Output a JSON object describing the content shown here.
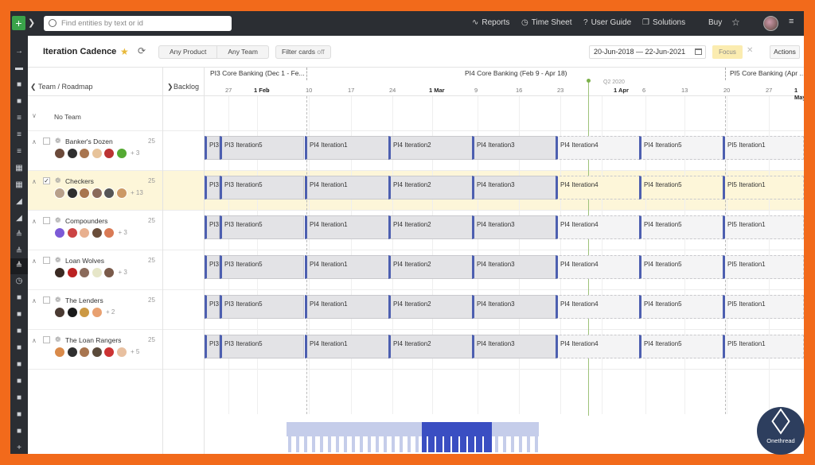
{
  "topbar": {
    "search_placeholder": "Find entities by text or id",
    "nav": [
      {
        "icon": "chart-line-icon",
        "label": "Reports"
      },
      {
        "icon": "clock-icon",
        "label": "Time Sheet"
      },
      {
        "icon": "question-icon",
        "label": "User Guide"
      },
      {
        "icon": "cube-icon",
        "label": "Solutions"
      }
    ],
    "buy_label": "Buy"
  },
  "page": {
    "title": "Iteration Cadence",
    "product_filter": "Any Product",
    "team_filter": "Any Team",
    "filter_cards_label": "Filter cards",
    "filter_cards_state": "off",
    "date_range": "20-Jun-2018 — 22-Jun-2021",
    "focus_label": "Focus",
    "actions_label": "Actions"
  },
  "grid": {
    "team_header": "Team / Roadmap",
    "backlog_header": "Backlog",
    "no_team_label": "No Team",
    "pis": [
      {
        "label": "PI3 Core Banking (Dec 1 - Fe..."
      },
      {
        "label": "PI4 Core Banking (Feb 9 - Apr 18)"
      },
      {
        "label": "PI5 Core Banking (Apr ..."
      }
    ],
    "quarter_label": "Q2 2020",
    "ticks": [
      "27",
      "1 Feb",
      "3",
      "10",
      "17",
      "24",
      "1 Mar",
      "9",
      "16",
      "23",
      "1 Apr",
      "6",
      "13",
      "20",
      "27",
      "1 May"
    ],
    "iterations": [
      "PI3",
      "PI3 Iteration5",
      "PI4 Iteration1",
      "PI4 Iteration2",
      "PI4 Iteration3",
      "PI4 Iteration4",
      "PI4 Iteration5",
      "PI5 Iteration1"
    ]
  },
  "teams": [
    {
      "name": "Banker's Dozen",
      "count": "25",
      "more": "+ 3",
      "checked": false,
      "highlight": false
    },
    {
      "name": "Checkers",
      "count": "25",
      "more": "+ 13",
      "checked": true,
      "highlight": true
    },
    {
      "name": "Compounders",
      "count": "25",
      "more": "+ 3",
      "checked": false,
      "highlight": false
    },
    {
      "name": "Loan Wolves",
      "count": "25",
      "more": "+ 3",
      "checked": false,
      "highlight": false
    },
    {
      "name": "The Lenders",
      "count": "25",
      "more": "+ 2",
      "checked": false,
      "highlight": false
    },
    {
      "name": "The Loan Rangers",
      "count": "25",
      "more": "+ 5",
      "checked": false,
      "highlight": false
    }
  ],
  "watermark": {
    "text": "Onethread"
  },
  "colors": {
    "accent": "#4d5fb0",
    "frame": "#f26a1b",
    "highlight": "#fdf6d9",
    "focus": "#fbecb0"
  }
}
